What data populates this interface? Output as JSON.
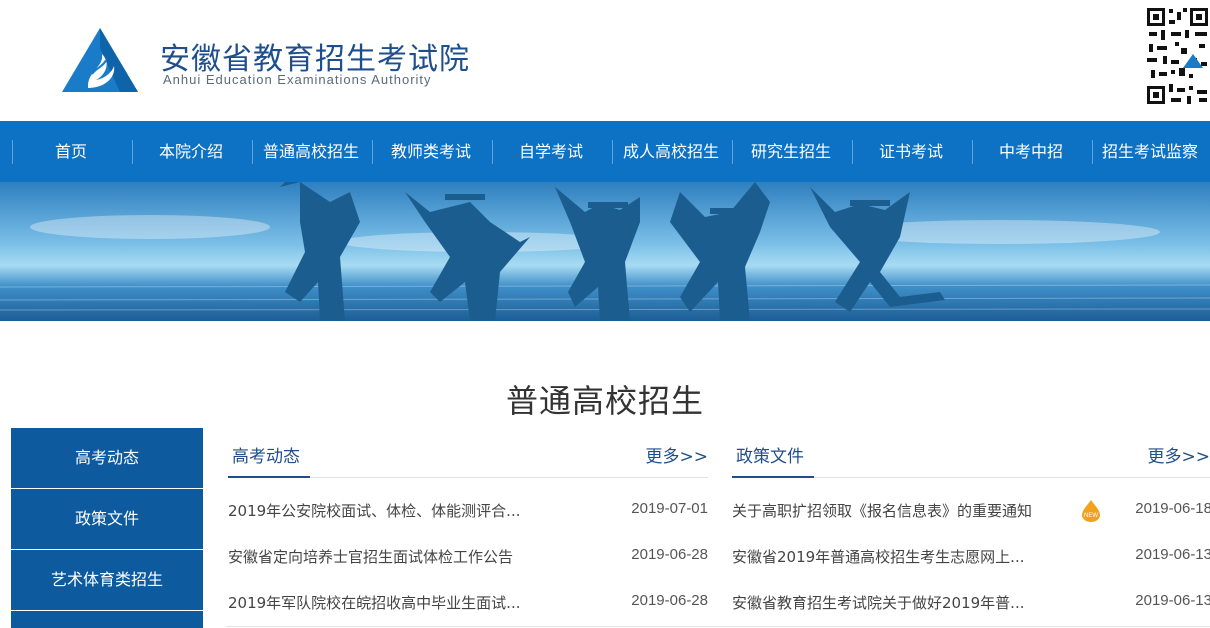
{
  "header": {
    "name_cn": "安徽省教育招生考试院",
    "name_en": "Anhui Education Examinations Authority"
  },
  "nav": {
    "items": [
      "首页",
      "本院介绍",
      "普通高校招生",
      "教师类考试",
      "自学考试",
      "成人高校招生",
      "研究生招生",
      "证书考试",
      "中考中招",
      "招生考试监察"
    ]
  },
  "section": {
    "title": "普通高校招生"
  },
  "sidebar": {
    "items": [
      "高考动态",
      "政策文件",
      "艺术体育类招生"
    ]
  },
  "left_panel": {
    "tab": "高考动态",
    "more": "更多>>",
    "news": [
      {
        "title": "2019年公安院校面试、体检、体能测评合...",
        "date": "2019-07-01"
      },
      {
        "title": "安徽省定向培养士官招生面试体检工作公告",
        "date": "2019-06-28"
      },
      {
        "title": "2019年军队院校在皖招收高中毕业生面试...",
        "date": "2019-06-28"
      }
    ]
  },
  "right_panel": {
    "tab": "政策文件",
    "more": "更多>>",
    "news": [
      {
        "title": "关于高职扩招领取《报名信息表》的重要通知",
        "date": "2019-06-18",
        "icon": "new-badge-icon"
      },
      {
        "title": "安徽省2019年普通高校招生考生志愿网上...",
        "date": "2019-06-13"
      },
      {
        "title": "安徽省教育招生考试院关于做好2019年普...",
        "date": "2019-06-13"
      }
    ]
  },
  "colors": {
    "nav_bg": "#0d72c4",
    "sidebar_bg": "#0d5a9e",
    "accent": "#1f4e8c"
  }
}
